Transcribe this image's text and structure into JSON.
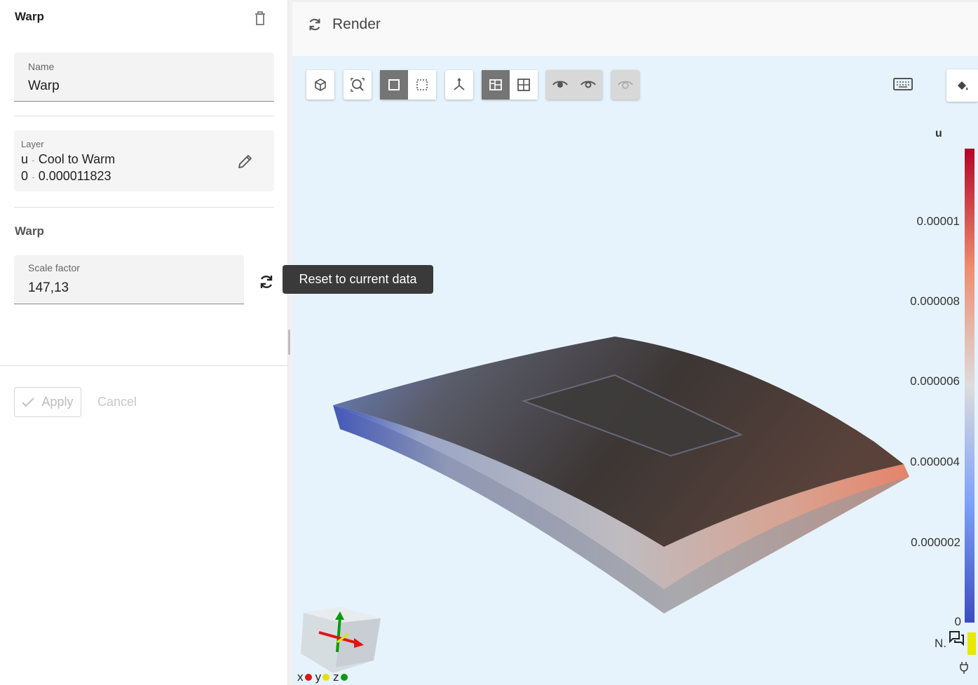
{
  "panel": {
    "title": "Warp",
    "name_field": {
      "label": "Name",
      "value": "Warp"
    },
    "layer": {
      "label": "Layer",
      "array": "u",
      "colormap": "Cool to Warm",
      "range_min": "0",
      "range_max": "0.000011823",
      "sep": "-"
    },
    "section_title": "Warp",
    "scale_field": {
      "label": "Scale factor",
      "value": "147,13"
    },
    "tooltip": "Reset to current data",
    "apply_label": "Apply",
    "cancel_label": "Cancel"
  },
  "render": {
    "title": "Render",
    "legend": {
      "title": "u",
      "ticks": [
        "0.00001",
        "0.000008",
        "0.000006",
        "0.000004",
        "0.000002",
        "0"
      ],
      "nan_label": "N.",
      "colors": [
        "#b40426",
        "#f08c6e",
        "#dddcdc",
        "#7da0f9",
        "#3b4cc0"
      ]
    },
    "axes": {
      "x": "x",
      "y": "y",
      "z": "z",
      "x_color": "#e01414",
      "y_color": "#e8e000",
      "z_color": "#0a9a0a"
    }
  }
}
